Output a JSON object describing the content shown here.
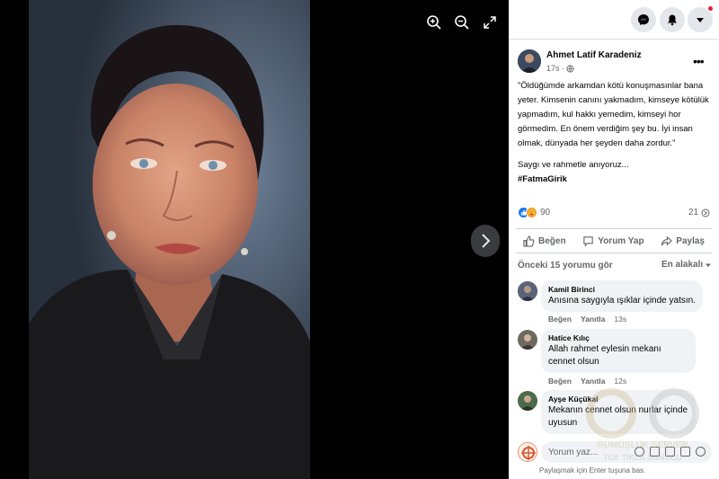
{
  "viewer": {
    "zoom_in_icon": "zoom-in-icon",
    "zoom_out_icon": "zoom-out-icon",
    "fullscreen_icon": "fullscreen-icon",
    "next_icon": "chevron-right-icon"
  },
  "header": {
    "icons": [
      "messenger-icon",
      "notifications-icon",
      "account-menu-icon"
    ],
    "notification_dot_color": "#e41e3f"
  },
  "post": {
    "author": "Ahmet Latif Karadeniz",
    "time": "17s ·",
    "text": "\"Öldüğümde arkamdan kötü konuşmasınlar bana yeter. Kimsenin canını yakmadım, kimseye kötülük yapmadım, kul hakkı yemedim, kimseyi hor görmedim. En önem verdiğim şey bu. İyi insan olmak, dünyada her şeyden daha zordur.\"",
    "tribute": "Saygı ve rahmetle anıyoruz...",
    "hashtag": "#FatmaGirik",
    "reaction_count": "90",
    "share_count": "21"
  },
  "actions": {
    "like": "Beğen",
    "comment": "Yorum Yap",
    "share": "Paylaş"
  },
  "comments_header": {
    "previous": "Önceki 15 yorumu gör",
    "sort": "En alakalı"
  },
  "comments": [
    {
      "name": "Kamil Birinci",
      "text": "Anısına saygıyla ışıklar içinde yatsın.",
      "like": "Beğen",
      "reply": "Yanıtla",
      "time": "13s"
    },
    {
      "name": "Hatice Kılıç",
      "text": "Allah rahmet eylesin mekanı cennet olsun",
      "like": "Beğen",
      "reply": "Yanıtla",
      "time": "12s"
    },
    {
      "name": "Ayşe Küçükal",
      "text": "Mekanın cennet olsun nurlar içinde uyusun"
    }
  ],
  "composer": {
    "placeholder": "Yorum yaz...",
    "hint": "Paylaşmak için Enter tuşuna bas."
  },
  "watermark": {
    "line1": "GÜMÜŞLÜK SERVER",
    "line2": "TEK TIKLA SUNUCU"
  },
  "colors": {
    "accent": "#1877f2",
    "secondary_text": "#65676b",
    "bubble": "#f0f2f5"
  }
}
